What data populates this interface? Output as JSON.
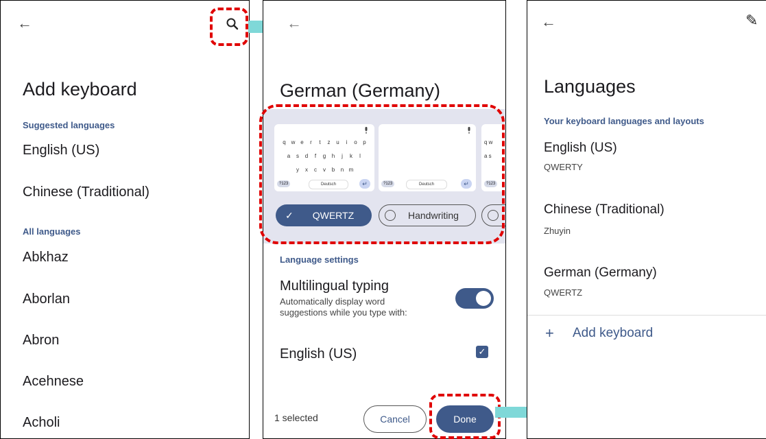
{
  "panel1": {
    "back_icon": "←",
    "search_icon": "🔍",
    "title": "Add keyboard",
    "suggested_header": "Suggested languages",
    "suggested": [
      "English (US)",
      "Chinese (Traditional)"
    ],
    "all_header": "All languages",
    "all": [
      "Abkhaz",
      "Aborlan",
      "Abron",
      "Acehnese",
      "Acholi"
    ]
  },
  "panel2": {
    "back_icon": "←",
    "title": "German (Germany)",
    "kb_row1": [
      "q",
      "w",
      "e",
      "r",
      "t",
      "z",
      "u",
      "i",
      "o",
      "p"
    ],
    "kb_row2": [
      "a",
      "s",
      "d",
      "f",
      "g",
      "h",
      "j",
      "k",
      "l"
    ],
    "kb_row3": [
      "y",
      "x",
      "c",
      "v",
      "b",
      "n",
      "m"
    ],
    "kb_sym": "?123",
    "kb_space": "Deutsch",
    "kb_partial_keys": "q w",
    "kb_partial_keys2": "a s",
    "layouts": [
      {
        "label": "QWERTZ",
        "selected": true
      },
      {
        "label": "Handwriting",
        "selected": false
      }
    ],
    "language_settings": "Language settings",
    "multilingual_title": "Multilingual typing",
    "multilingual_desc": "Automatically display word suggestions while you type with:",
    "multilingual_on": true,
    "extra_language": "English (US)",
    "extra_language_checked": true,
    "selected_count": "1 selected",
    "cancel_label": "Cancel",
    "done_label": "Done"
  },
  "panel3": {
    "back_icon": "←",
    "edit_icon": "✎",
    "title": "Languages",
    "section": "Your keyboard languages and layouts",
    "languages": [
      {
        "name": "English (US)",
        "layout": "QWERTY"
      },
      {
        "name": "Chinese (Traditional)",
        "layout": "Zhuyin"
      },
      {
        "name": "German (Germany)",
        "layout": "QWERTZ"
      }
    ],
    "add_icon": "+",
    "add_label": "Add keyboard"
  },
  "colors": {
    "accent": "#3f5a8a",
    "highlight": "#e00000",
    "arrow": "#7fd8d8",
    "preview_bg": "#e3e4ef"
  }
}
